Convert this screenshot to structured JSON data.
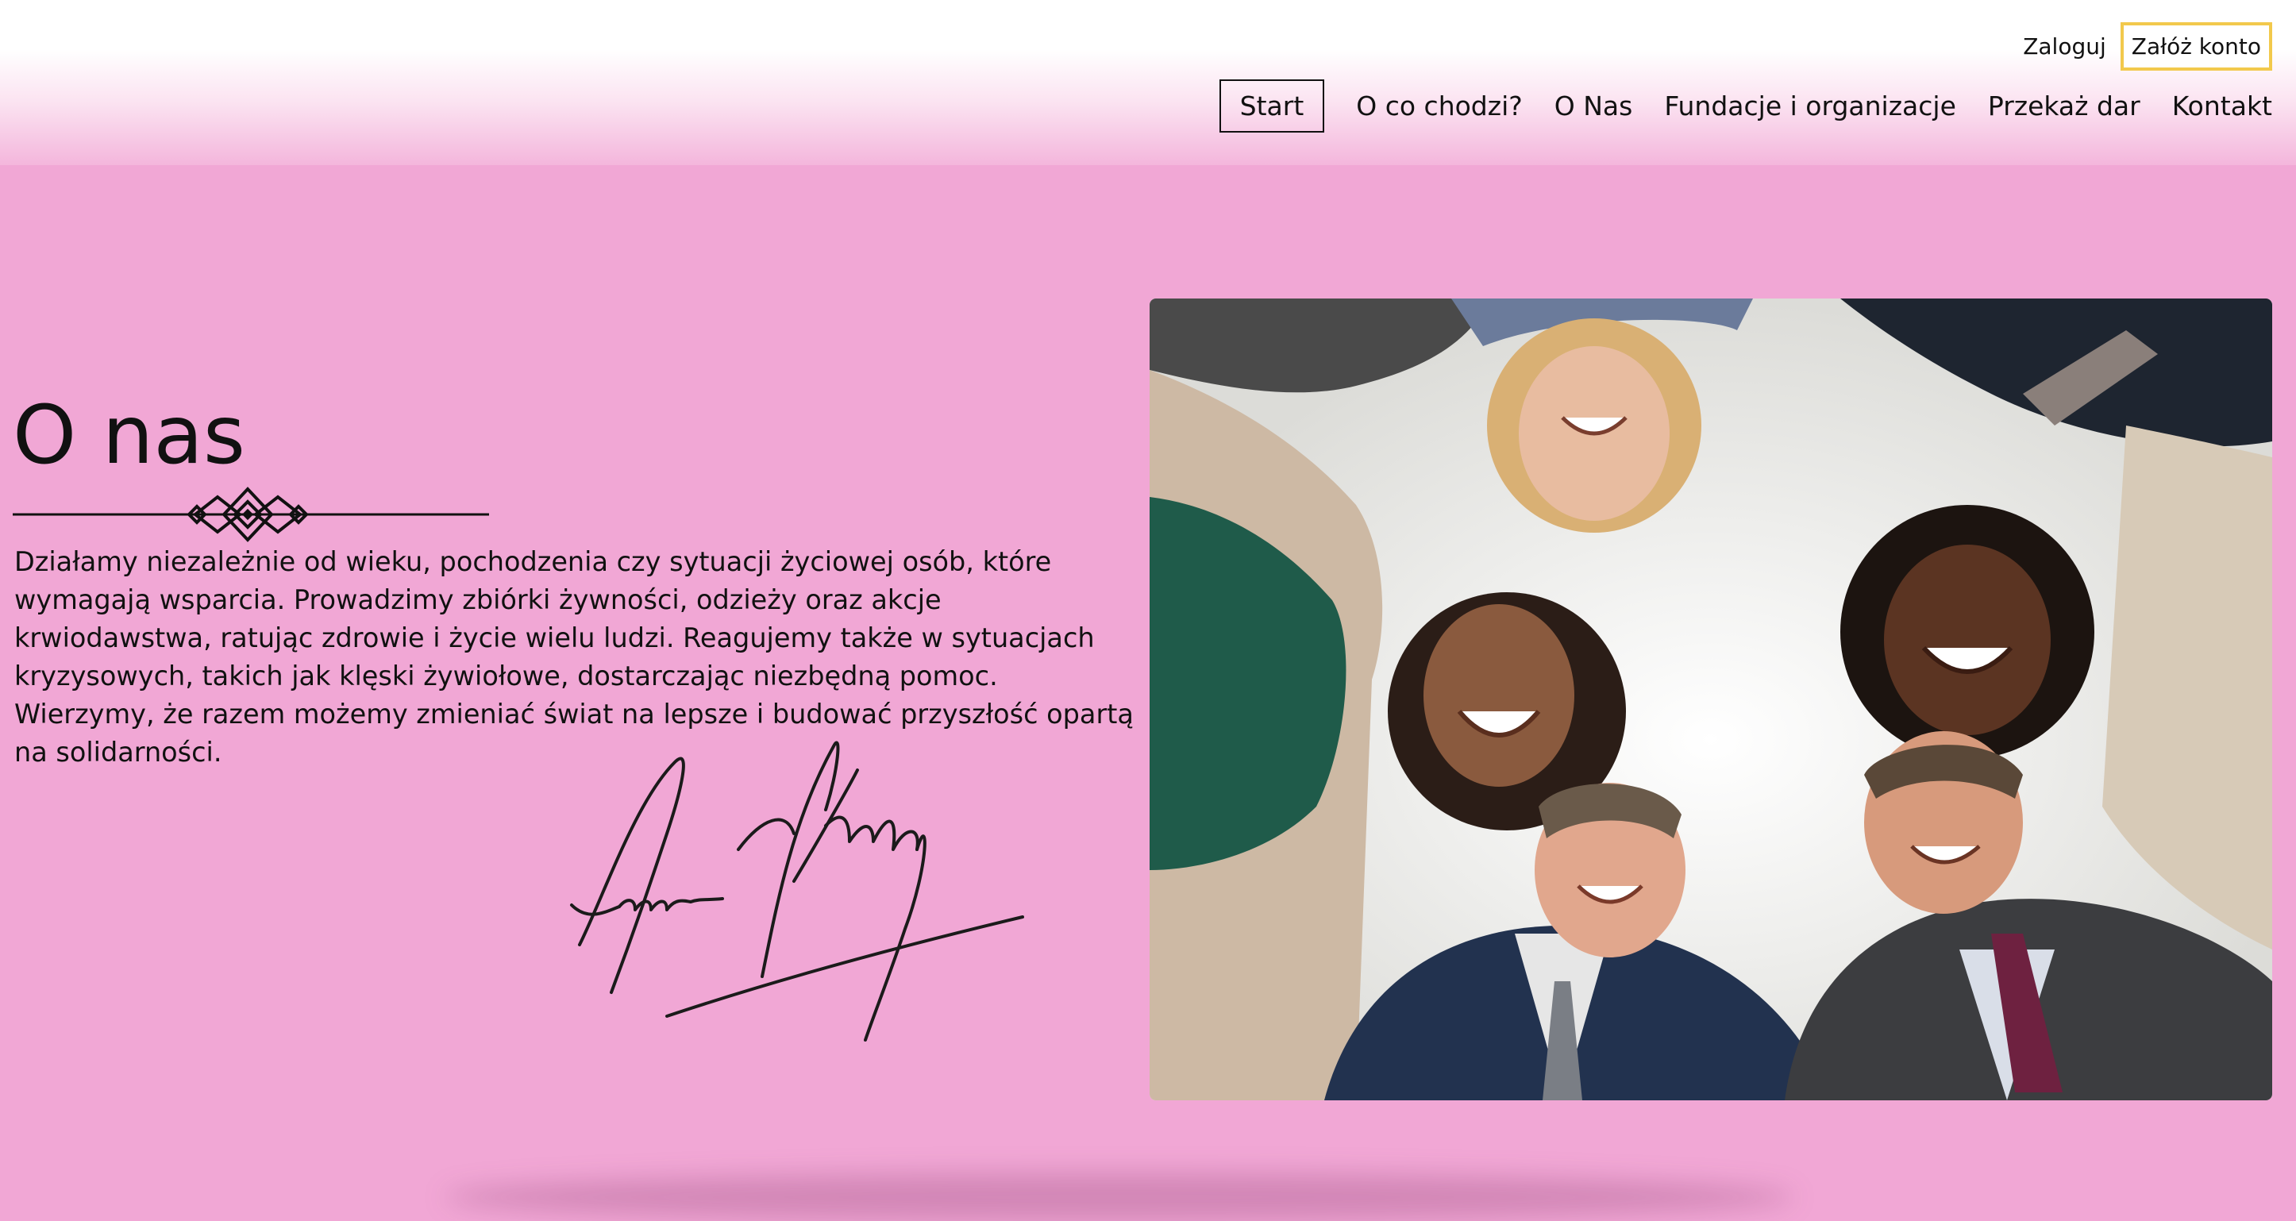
{
  "header": {
    "login_label": "Zaloguj",
    "register_label": "Załóż konto",
    "nav": [
      {
        "label": "Start",
        "active": true
      },
      {
        "label": "O co chodzi?",
        "active": false
      },
      {
        "label": "O Nas",
        "active": false
      },
      {
        "label": "Fundacje i organizacje",
        "active": false
      },
      {
        "label": "Przekaż dar",
        "active": false
      },
      {
        "label": "Kontakt",
        "active": false
      }
    ]
  },
  "about": {
    "title": "O nas",
    "text": "Działamy niezależnie od wieku, pochodzenia czy sytuacji życiowej osób, które wymagają wsparcia. Prowadzimy zbiórki żywności, odzieży oraz akcje krwiodawstwa, ratując zdrowie i życie wielu ludzi. Reagujemy także w sytuacjach kryzysowych, takich jak klęski żywiołowe, dostarczając niezbędną pomoc. Wierzymy, że razem możemy zmieniać świat na lepsze i budować przyszłość opartą na solidarności."
  },
  "colors": {
    "background": "#f1a7d5",
    "register_border": "#f2c94c",
    "text": "#111111"
  },
  "icons": [
    "ornament-divider-icon",
    "signature-image",
    "team-huddle-photo"
  ]
}
